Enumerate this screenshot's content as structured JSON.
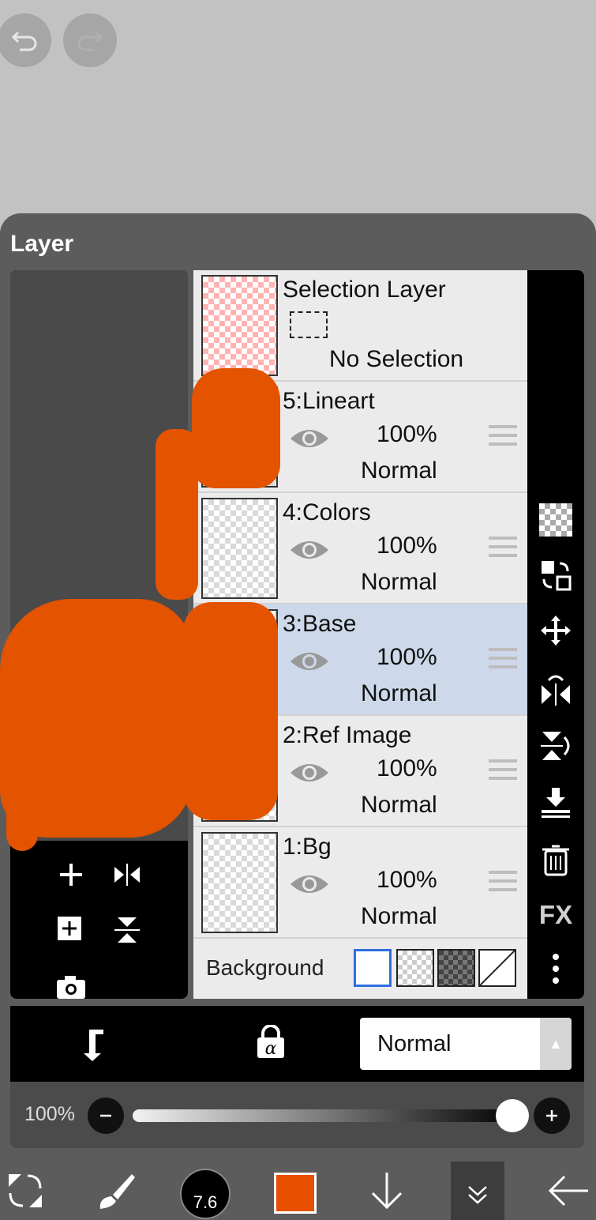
{
  "colors": {
    "accent": "#e84f00",
    "selected_row": "#cdd9ea"
  },
  "panel": {
    "title": "Layer"
  },
  "selection_layer": {
    "name": "Selection Layer",
    "status": "No Selection"
  },
  "layers": [
    {
      "name": "5:Lineart",
      "opacity": "100%",
      "blend": "Normal",
      "selected": false
    },
    {
      "name": "4:Colors",
      "opacity": "100%",
      "blend": "Normal",
      "selected": false
    },
    {
      "name": "3:Base",
      "opacity": "100%",
      "blend": "Normal",
      "selected": true
    },
    {
      "name": "2:Ref Image",
      "opacity": "100%",
      "blend": "Normal",
      "selected": false
    },
    {
      "name": "1:Bg",
      "opacity": "100%",
      "blend": "Normal",
      "selected": false
    }
  ],
  "background": {
    "label": "Background",
    "options": [
      "white",
      "checker-light",
      "checker-dark",
      "none"
    ],
    "selected": "white"
  },
  "side_tools": {
    "fx_label": "FX"
  },
  "blend_bar": {
    "mode": "Normal"
  },
  "opacity_bar": {
    "label": "100%",
    "value": 1.0
  },
  "bottom_bar": {
    "brush_size": "7.6",
    "current_color": "#e84f00"
  }
}
